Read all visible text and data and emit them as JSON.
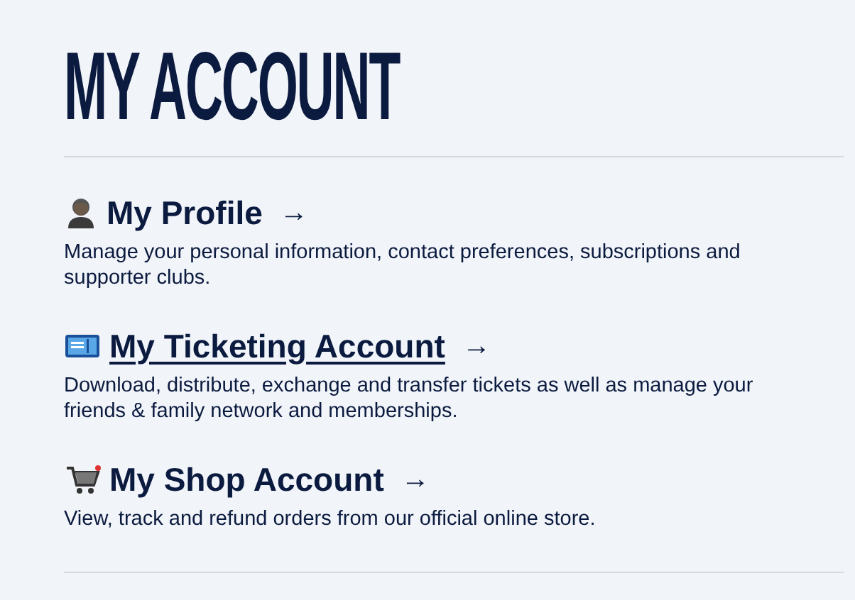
{
  "title": "MY ACCOUNT",
  "sections": [
    {
      "kind": "person",
      "heading": "My Profile",
      "arrow": "→",
      "underlined": false,
      "description": "Manage your personal information, contact preferences, subscriptions and supporter clubs."
    },
    {
      "kind": "ticket",
      "heading": "My Ticketing Account",
      "arrow": "→",
      "underlined": true,
      "description": "Download, distribute, exchange and transfer tickets as well as manage your friends & family network and memberships."
    },
    {
      "kind": "cart",
      "heading": "My Shop Account",
      "arrow": "→",
      "underlined": false,
      "description": "View, track and refund orders from our official online store."
    }
  ]
}
